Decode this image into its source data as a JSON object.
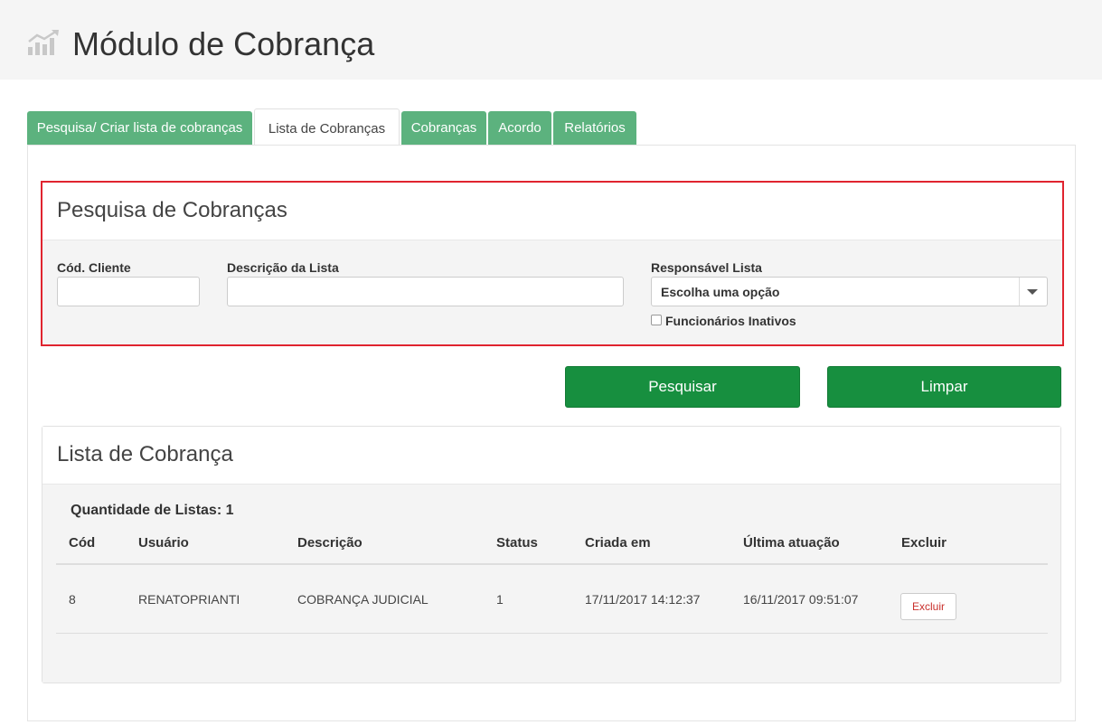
{
  "header": {
    "title": "Módulo de Cobrança",
    "icon": "chart-growth-icon"
  },
  "tabs": [
    {
      "label": "Pesquisa/ Criar lista de cobranças",
      "active": false
    },
    {
      "label": "Lista de Cobranças",
      "active": true
    },
    {
      "label": "Cobranças",
      "active": false
    },
    {
      "label": "Acordo",
      "active": false
    },
    {
      "label": "Relatórios",
      "active": false
    }
  ],
  "search": {
    "title": "Pesquisa de Cobranças",
    "cod_cliente": {
      "label": "Cód. Cliente",
      "value": ""
    },
    "descricao": {
      "label": "Descrição da Lista",
      "value": ""
    },
    "responsavel": {
      "label": "Responsável Lista",
      "selected": "Escolha uma opção"
    },
    "inativos": {
      "label": "Funcionários Inativos",
      "checked": false
    }
  },
  "actions": {
    "search_label": "Pesquisar",
    "clear_label": "Limpar"
  },
  "list": {
    "title": "Lista de Cobrança",
    "count_text": "Quantidade de Listas: 1",
    "columns": [
      "Cód",
      "Usuário",
      "Descrição",
      "Status",
      "Criada em",
      "Última atuação",
      "Excluir"
    ],
    "rows": [
      {
        "cod": "8",
        "usuario": "RENATOPRIANTI",
        "descricao": "COBRANÇA JUDICIAL",
        "status": "1",
        "criada_em": "17/11/2017 14:12:37",
        "ultima_atuacao": "16/11/2017 09:51:07",
        "excluir_label": "Excluir"
      }
    ]
  },
  "colors": {
    "tab_green": "#5cb27e",
    "button_green": "#178f3f",
    "highlight_red": "#e0242f"
  }
}
